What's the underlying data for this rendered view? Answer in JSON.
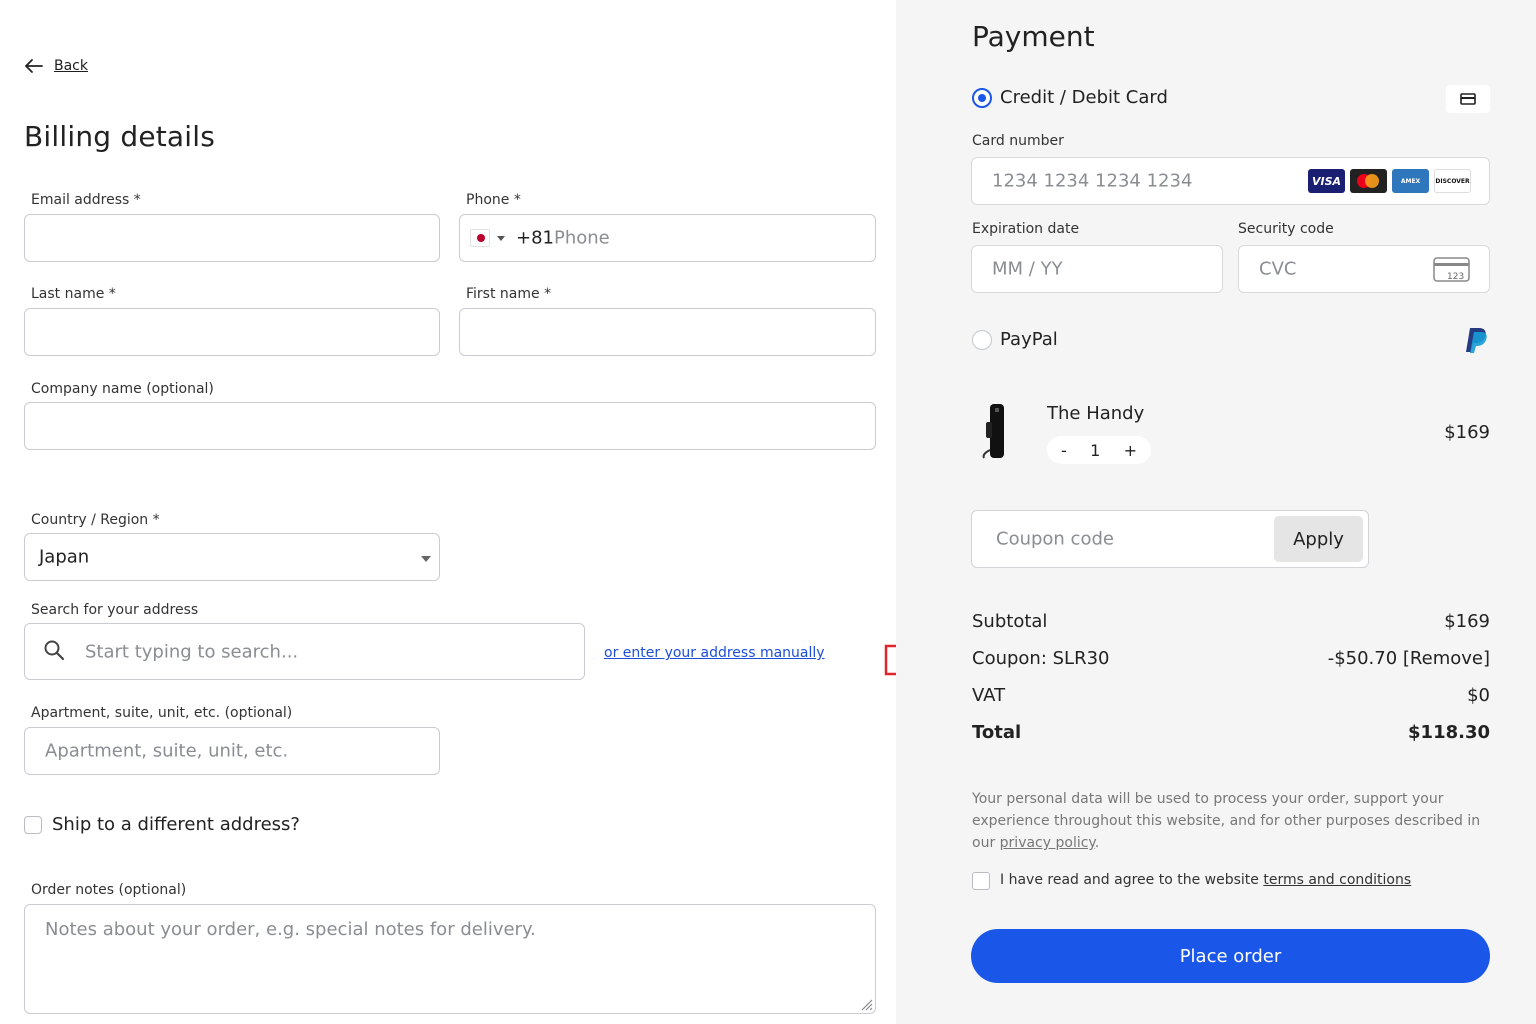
{
  "billing": {
    "back_label": "Back",
    "title": "Billing details",
    "email_label": "Email address *",
    "phone_label": "Phone *",
    "phone_code": "+81",
    "phone_placeholder": "Phone",
    "last_name_label": "Last name *",
    "first_name_label": "First name *",
    "company_label": "Company name (optional)",
    "country_label": "Country / Region *",
    "country_value": "Japan",
    "search_label": "Search for your address",
    "search_placeholder": "Start typing to search...",
    "manual_link": "or enter your address manually",
    "apartment_label": "Apartment, suite, unit, etc. (optional)",
    "apartment_placeholder": "Apartment, suite, unit, etc.",
    "ship_different_label": "Ship to a different address?",
    "order_notes_label": "Order notes (optional)",
    "order_notes_placeholder": "Notes about your order, e.g. special notes for delivery."
  },
  "payment": {
    "title": "Payment",
    "card_option": "Credit / Debit Card",
    "card_number_label": "Card number",
    "card_number_placeholder": "1234 1234 1234 1234",
    "brands": [
      "VISA",
      "mastercard",
      "AMEX",
      "DISCOVER"
    ],
    "expiration_label": "Expiration date",
    "expiration_placeholder": "MM / YY",
    "security_label": "Security code",
    "security_placeholder": "CVC",
    "cvc_icon_text": "123",
    "paypal_option": "PayPal"
  },
  "product": {
    "name": "The Handy",
    "quantity": "1",
    "minus": "-",
    "plus": "+",
    "price": "$169"
  },
  "coupon": {
    "placeholder": "Coupon code",
    "apply_label": "Apply"
  },
  "summary": {
    "subtotal_label": "Subtotal",
    "subtotal_value": "$169",
    "coupon_label": "Coupon: SLR30",
    "coupon_value": "-$50.70 [Remove]",
    "vat_label": "VAT",
    "vat_value": "$0",
    "total_label": "Total",
    "total_value": "$118.30"
  },
  "legal": {
    "privacy_text": "Your personal data will be used to process your order, support your experience throughout this website, and for other purposes described in our ",
    "privacy_link": "privacy policy",
    "privacy_end": ".",
    "terms_text": "I have read and agree to the website ",
    "terms_link": "terms and conditions"
  },
  "place_order_label": "Place order",
  "colors": {
    "accent": "#1a56e8",
    "link": "#1d4ed8",
    "annotation_arrow": "#e0262b",
    "panel_bg": "#f5f5f5"
  }
}
